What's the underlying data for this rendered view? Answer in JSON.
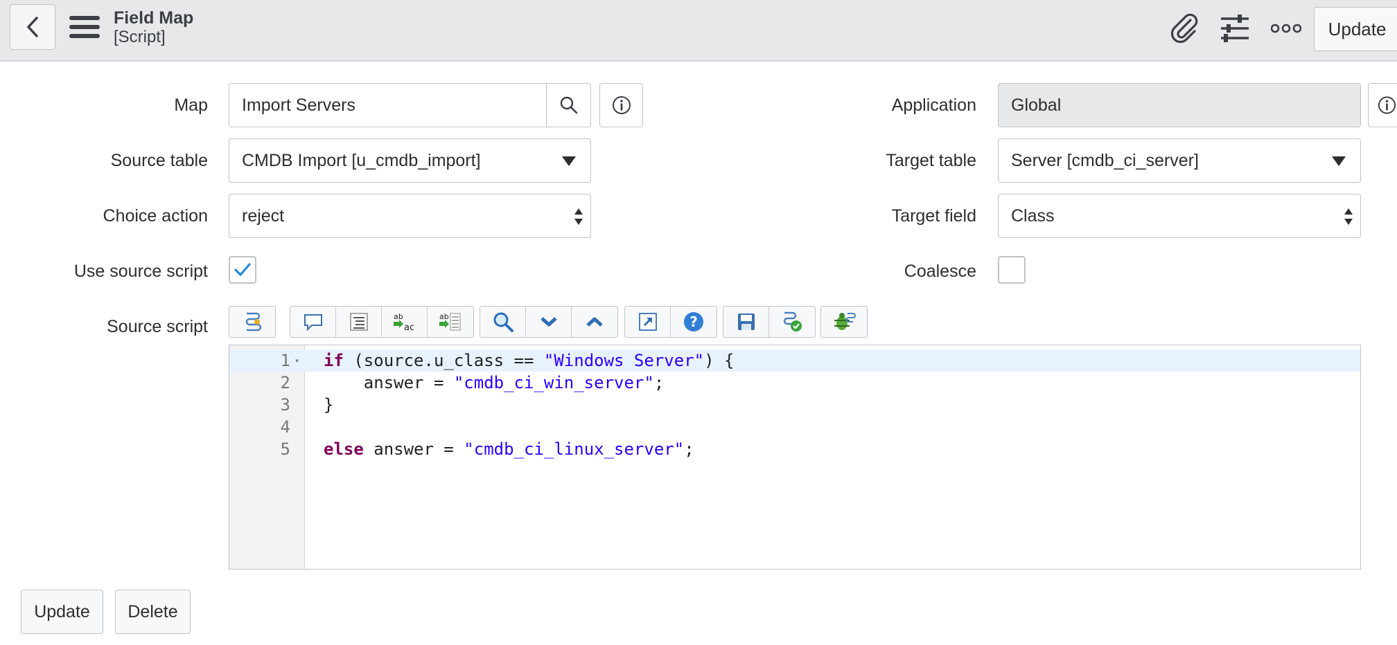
{
  "header": {
    "title": "Field Map",
    "subtitle": "[Script]",
    "update_label": "Update",
    "icons": [
      "chevron-left-icon",
      "hamburger-menu-icon",
      "paperclip-icon",
      "sliders-icon",
      "more-icon"
    ]
  },
  "form": {
    "map": {
      "label": "Map",
      "value": "Import Servers"
    },
    "application": {
      "label": "Application",
      "value": "Global"
    },
    "source_table": {
      "label": "Source table",
      "value": "CMDB Import [u_cmdb_import]"
    },
    "target_table": {
      "label": "Target table",
      "value": "Server [cmdb_ci_server]"
    },
    "choice_action": {
      "label": "Choice action",
      "value": "reject"
    },
    "target_field": {
      "label": "Target field",
      "value": "Class"
    },
    "use_source_script": {
      "label": "Use source script",
      "checked": true
    },
    "coalesce": {
      "label": "Coalesce",
      "checked": false
    },
    "source_script": {
      "label": "Source script"
    }
  },
  "editor": {
    "line_numbers": [
      "1",
      "2",
      "3",
      "4",
      "5"
    ],
    "lines": [
      [
        {
          "t": "kw",
          "v": "if"
        },
        {
          "t": "p",
          "v": " (source.u_class == "
        },
        {
          "t": "str",
          "v": "\"Windows Server\""
        },
        {
          "t": "p",
          "v": ") {"
        }
      ],
      [
        {
          "t": "p",
          "v": "    answer = "
        },
        {
          "t": "str",
          "v": "\"cmdb_ci_win_server\""
        },
        {
          "t": "p",
          "v": ";"
        }
      ],
      [
        {
          "t": "p",
          "v": "}"
        }
      ],
      [],
      [
        {
          "t": "kw",
          "v": "else"
        },
        {
          "t": "p",
          "v": " answer = "
        },
        {
          "t": "str",
          "v": "\"cmdb_ci_linux_server\""
        },
        {
          "t": "p",
          "v": ";"
        }
      ]
    ]
  },
  "toolbar": {
    "icons": [
      "script-assistant-icon",
      "comment-icon",
      "format-code-icon",
      "replace-icon",
      "replace-all-icon",
      "search-icon",
      "find-next-icon",
      "find-previous-icon",
      "fullscreen-icon",
      "help-icon",
      "save-icon",
      "syntax-check-icon",
      "debug-icon"
    ]
  },
  "colors": {
    "accent": "#1f8ce6",
    "keyword": "#7f0055",
    "string": "#2a00ff",
    "header_bg": "#e6e8ea"
  },
  "actions": {
    "update_label": "Update",
    "delete_label": "Delete"
  }
}
